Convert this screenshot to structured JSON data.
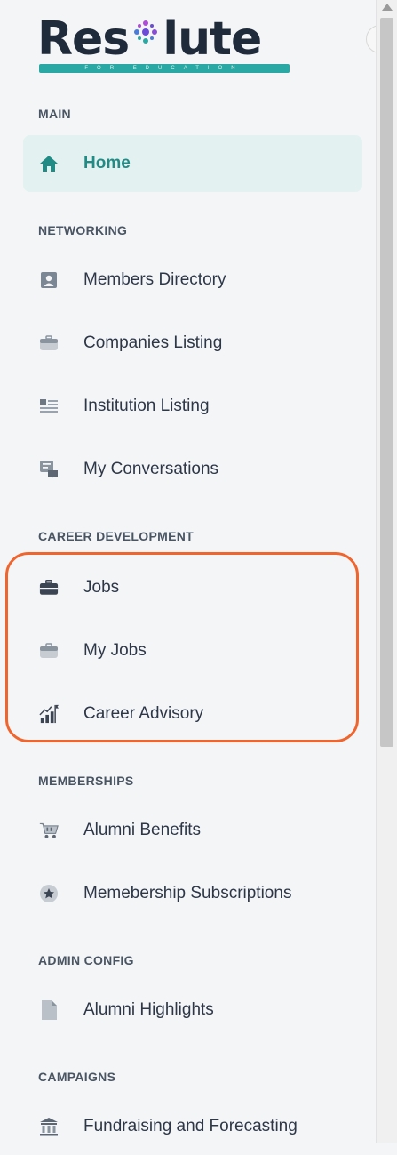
{
  "logo": {
    "name": "Res lute",
    "left": "Res",
    "right": "lute",
    "tagline": "FOR EDUCATION"
  },
  "sections": {
    "main": "MAIN",
    "networking": "NETWORKING",
    "career": "CAREER DEVELOPMENT",
    "memberships": "MEMBERSHIPS",
    "admin": "ADMIN CONFIG",
    "campaigns": "CAMPAIGNS"
  },
  "items": {
    "home": "Home",
    "members_directory": "Members Directory",
    "companies_listing": "Companies Listing",
    "institution_listing": "Institution Listing",
    "my_conversations": "My Conversations",
    "jobs": "Jobs",
    "my_jobs": "My Jobs",
    "career_advisory": "Career Advisory",
    "alumni_benefits": "Alumni Benefits",
    "membership_subscriptions": "Memebership Subscriptions",
    "alumni_highlights": "Alumni Highlights",
    "fundraising": "Fundraising and Forecasting"
  },
  "icons": {
    "home": "home-icon",
    "members_directory": "user-card-icon",
    "companies_listing": "briefcase-icon",
    "institution_listing": "list-icon",
    "my_conversations": "chat-icon",
    "jobs": "briefcase-icon",
    "my_jobs": "briefcase-icon",
    "career_advisory": "growth-chart-icon",
    "alumni_benefits": "cart-icon",
    "membership_subscriptions": "star-badge-icon",
    "alumni_highlights": "document-icon",
    "fundraising": "bank-icon"
  },
  "colors": {
    "accent": "#2aa8a3",
    "active_bg": "#e3f2f1",
    "highlight": "#f0652d",
    "text": "#2d3748"
  }
}
